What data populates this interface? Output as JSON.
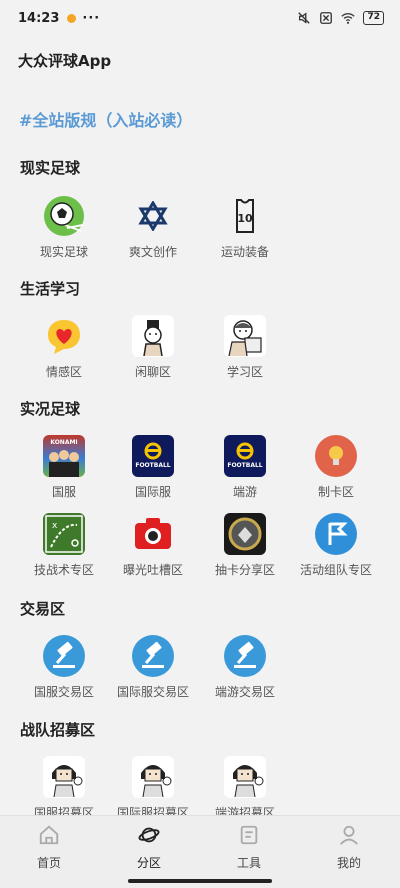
{
  "status_bar": {
    "time": "14:23",
    "dots": "···",
    "battery": "72"
  },
  "app_title": "大众评球App",
  "rules_link": "#全站版规（入站必读）",
  "sections": {
    "real_football": {
      "title": "现实足球",
      "items": [
        {
          "label": "现实足球",
          "icon": "soccer-ball-icon"
        },
        {
          "label": "爽文创作",
          "icon": "star-of-david-icon"
        },
        {
          "label": "运动装备",
          "icon": "jersey-icon",
          "badge": "10"
        }
      ]
    },
    "life_study": {
      "title": "生活学习",
      "items": [
        {
          "label": "情感区",
          "icon": "heart-chat-icon"
        },
        {
          "label": "闲聊区",
          "icon": "cartoon-chat-icon"
        },
        {
          "label": "学习区",
          "icon": "cartoon-study-icon"
        }
      ]
    },
    "live_football": {
      "title": "实况足球",
      "items": [
        {
          "label": "国服",
          "icon": "konami-poster-icon",
          "text": "KONAMI"
        },
        {
          "label": "国际服",
          "icon": "efootball-icon",
          "text": "FOOTBALL"
        },
        {
          "label": "端游",
          "icon": "efootball-icon",
          "text": "FOOTBALL"
        },
        {
          "label": "制卡区",
          "icon": "lightbulb-icon"
        },
        {
          "label": "技战术专区",
          "icon": "tactics-board-icon"
        },
        {
          "label": "曝光吐槽区",
          "icon": "camera-icon"
        },
        {
          "label": "抽卡分享区",
          "icon": "card-pack-icon"
        },
        {
          "label": "活动组队专区",
          "icon": "flag-icon"
        }
      ]
    },
    "trade": {
      "title": "交易区",
      "items": [
        {
          "label": "国服交易区",
          "icon": "gavel-icon"
        },
        {
          "label": "国际服交易区",
          "icon": "gavel-icon"
        },
        {
          "label": "端游交易区",
          "icon": "gavel-icon"
        }
      ]
    },
    "recruit": {
      "title": "战队招募区",
      "items": [
        {
          "label": "国服招募区",
          "icon": "recruit-meme-icon"
        },
        {
          "label": "国际服招募区",
          "icon": "recruit-meme-icon"
        },
        {
          "label": "端游招募区",
          "icon": "recruit-meme-icon"
        }
      ]
    }
  },
  "tabbar": {
    "items": [
      {
        "label": "首页",
        "icon": "home-icon"
      },
      {
        "label": "分区",
        "icon": "planet-icon"
      },
      {
        "label": "工具",
        "icon": "document-icon"
      },
      {
        "label": "我的",
        "icon": "person-icon"
      }
    ],
    "active_index": 1
  },
  "colors": {
    "accent_link": "#5b9bd5",
    "background": "#f2f2f2",
    "gavel_blue": "#3a9ad9"
  }
}
